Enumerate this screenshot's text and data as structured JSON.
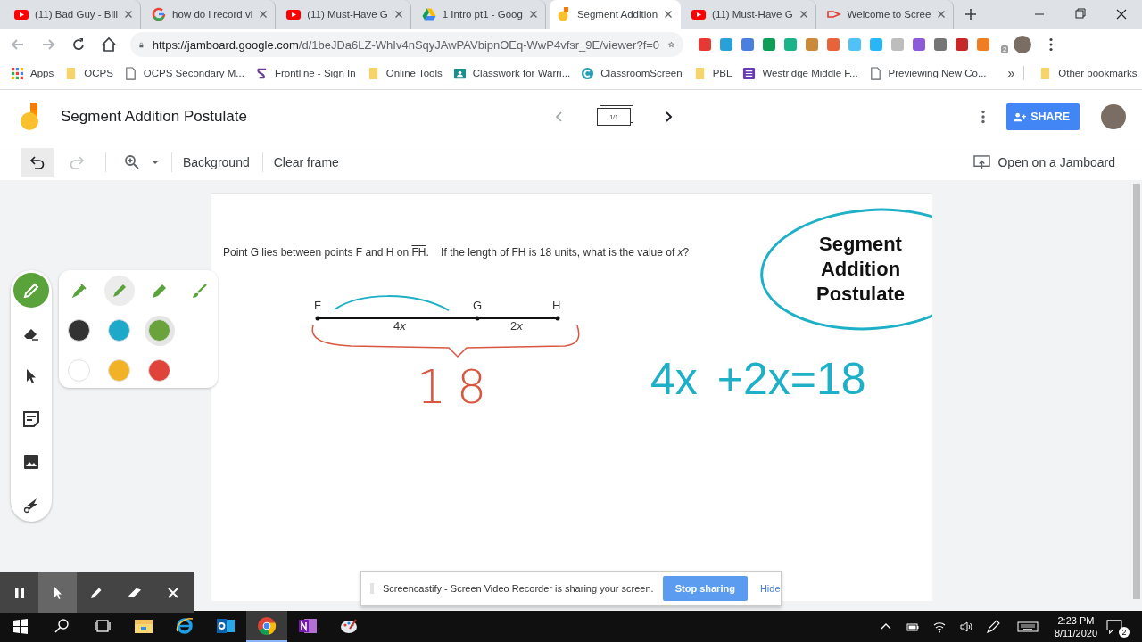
{
  "browser": {
    "tabs": [
      {
        "title": "(11) Bad Guy - Bill",
        "kind": "youtube",
        "selected": false
      },
      {
        "title": "how do i record vi",
        "kind": "google",
        "selected": false
      },
      {
        "title": "(11) Must-Have G",
        "kind": "youtube",
        "selected": false
      },
      {
        "title": "1 Intro pt1 - Goog",
        "kind": "drive",
        "selected": false
      },
      {
        "title": "Segment Addition",
        "kind": "jamboard",
        "selected": true
      },
      {
        "title": "(11) Must-Have G",
        "kind": "youtube",
        "selected": false
      },
      {
        "title": "Welcome to Scree",
        "kind": "screencastify",
        "selected": false
      }
    ],
    "url_host": "https://jamboard.google.com",
    "url_path": "/d/1beJDa6LZ-WhIv4nSqyJAwPAVbipnOEq-WwP4vfsr_9E/viewer?f=0",
    "extension_badge": "2",
    "bookmarks": [
      {
        "label": "Apps",
        "kind": "apps"
      },
      {
        "label": "OCPS",
        "kind": "folder"
      },
      {
        "label": "OCPS Secondary M...",
        "kind": "page"
      },
      {
        "label": "Frontline - Sign In",
        "kind": "frontline"
      },
      {
        "label": "Online Tools",
        "kind": "folder"
      },
      {
        "label": "Classwork for Warri...",
        "kind": "classroom"
      },
      {
        "label": "ClassroomScreen",
        "kind": "classroomscreen"
      },
      {
        "label": "PBL",
        "kind": "folder"
      },
      {
        "label": "Westridge Middle F...",
        "kind": "form"
      },
      {
        "label": "Previewing New Co...",
        "kind": "page"
      }
    ],
    "more_bookmarks": "»",
    "other_bookmarks": "Other bookmarks"
  },
  "jamboard": {
    "title": "Segment Addition Postulate",
    "frame_indicator": "1/1",
    "prev_disabled": true,
    "next_disabled": false,
    "share": "SHARE",
    "actions": [
      {
        "kind": "undo",
        "disabled": false
      },
      {
        "kind": "redo",
        "disabled": true
      }
    ],
    "background": "Background",
    "clear": "Clear frame",
    "open_on": "Open on a Jamboard",
    "tools": [
      {
        "kind": "pen",
        "selected": true
      },
      {
        "kind": "eraser",
        "selected": false
      },
      {
        "kind": "select",
        "selected": false
      },
      {
        "kind": "sticky-note",
        "selected": false
      },
      {
        "kind": "image",
        "selected": false
      },
      {
        "kind": "laser",
        "selected": false
      }
    ],
    "pens": [
      {
        "kind": "pen",
        "selected": false
      },
      {
        "kind": "marker",
        "selected": true
      },
      {
        "kind": "highlighter",
        "selected": false
      },
      {
        "kind": "brush",
        "selected": false
      }
    ],
    "colors": [
      {
        "color": "#333333",
        "selected": false
      },
      {
        "color": "#1ea8c9",
        "selected": false
      },
      {
        "color": "#6aa23c",
        "selected": true
      },
      {
        "color": "#ffffff",
        "selected": false
      },
      {
        "color": "#f2b225",
        "selected": false
      },
      {
        "color": "#e0433a",
        "selected": false
      }
    ],
    "canvas": {
      "question": {
        "before": "Point G lies between points F and H on ",
        "segment": "FH",
        "after": ".    If the length of FH is 18 units, what is the value of *x*?"
      },
      "points": [
        {
          "label": "F"
        },
        {
          "label": "G"
        },
        {
          "label": "H"
        }
      ],
      "parts": [
        {
          "coefficient": "4",
          "variable": "x"
        },
        {
          "coefficient": "2",
          "variable": "x"
        }
      ],
      "brace_total": "18",
      "equation": [
        "4x",
        "+2x=18"
      ],
      "sticker": "Segment Addition Postulate"
    }
  },
  "screencastify": {
    "tools": [
      {
        "kind": "pause",
        "selected": false
      },
      {
        "kind": "cursor",
        "selected": true
      },
      {
        "kind": "pen",
        "selected": false
      },
      {
        "kind": "eraser",
        "selected": false
      },
      {
        "kind": "close",
        "selected": false
      }
    ],
    "message": "Screencastify - Screen Video Recorder is sharing your screen.",
    "stop": "Stop sharing",
    "hide": "Hide"
  },
  "taskbar": {
    "apps": [
      {
        "kind": "explorer",
        "selected": false
      },
      {
        "kind": "ie",
        "selected": false
      },
      {
        "kind": "outlook",
        "selected": false
      },
      {
        "kind": "chrome",
        "selected": true
      },
      {
        "kind": "onenote",
        "selected": false
      },
      {
        "kind": "paint",
        "selected": false
      }
    ],
    "time": "2:23 PM",
    "date": "8/11/2020",
    "notifications": "2"
  }
}
